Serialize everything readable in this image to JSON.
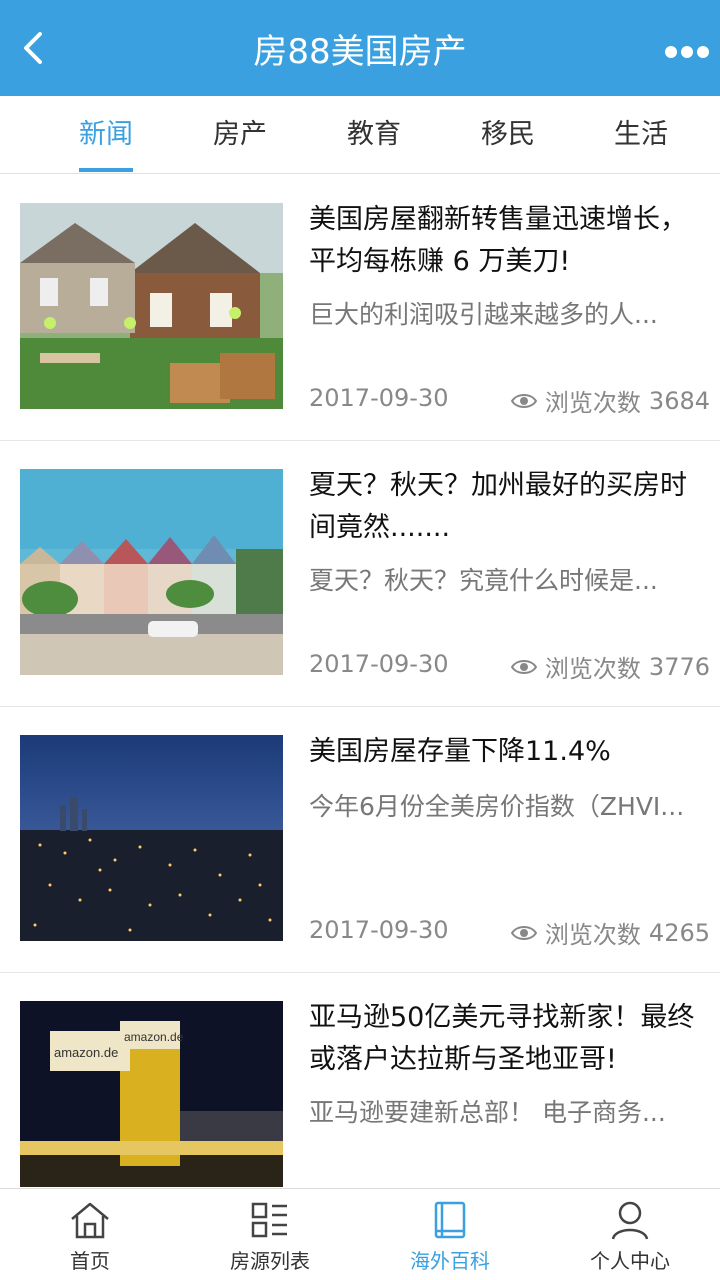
{
  "header": {
    "title": "房88美国房产",
    "back_icon": "chevron-left-icon",
    "more_icon": "more-dots-icon",
    "color": "#3aa0e0"
  },
  "tabs": [
    {
      "label": "新闻",
      "active": true
    },
    {
      "label": "房产",
      "active": false
    },
    {
      "label": "教育",
      "active": false
    },
    {
      "label": "移民",
      "active": false
    },
    {
      "label": "生活",
      "active": false
    }
  ],
  "articles": [
    {
      "title": "美国房屋翻新转售量迅速增长，平均每栋赚 6 万美刀!",
      "desc": "巨大的利润吸引越来越多的人...",
      "date": "2017-09-30",
      "views_label": "浏览次数",
      "views": "3684"
    },
    {
      "title": "夏天？秋天？加州最好的买房时间竟然.......",
      "desc": "夏天？秋天？究竟什么时候是...",
      "date": "2017-09-30",
      "views_label": "浏览次数",
      "views": "3776"
    },
    {
      "title": "美国房屋存量下降11.4%",
      "desc": "今年6月份全美房价指数（ZHVI...",
      "date": "2017-09-30",
      "views_label": "浏览次数",
      "views": "4265"
    },
    {
      "title": "亚马逊50亿美元寻找新家！最终或落户达拉斯与圣地亚哥!",
      "desc": "亚马逊要建新总部！ 电子商务...",
      "date": "",
      "views_label": "",
      "views": "",
      "sign_text_1": "amazon.de",
      "sign_text_2": "amazon.de"
    }
  ],
  "bottom_nav": [
    {
      "label": "首页",
      "icon": "home-icon",
      "active": false
    },
    {
      "label": "房源列表",
      "icon": "list-icon",
      "active": false
    },
    {
      "label": "海外百科",
      "icon": "book-icon",
      "active": true
    },
    {
      "label": "个人中心",
      "icon": "user-icon",
      "active": false
    }
  ]
}
